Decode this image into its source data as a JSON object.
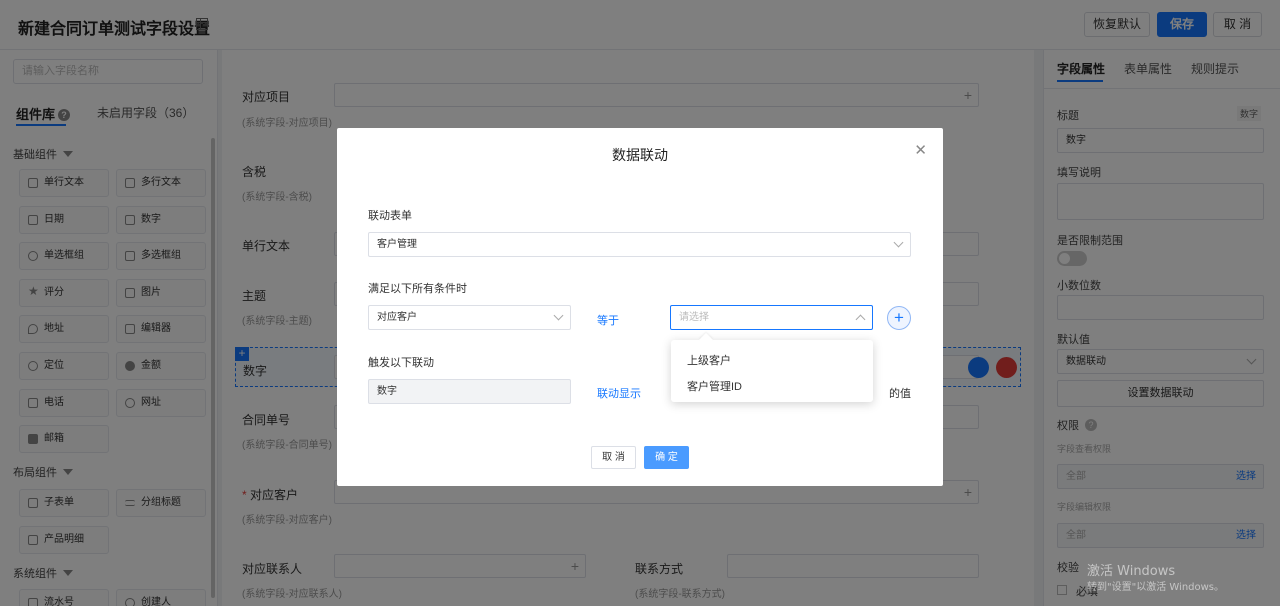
{
  "header": {
    "title": "新建合同订单测试字段设置",
    "btn_restore": "恢复默认",
    "btn_save": "保存",
    "btn_cancel": "取 消"
  },
  "left": {
    "search_placeholder": "请输入字段名称",
    "tab_library": "组件库",
    "tab_unused": "未启用字段（36）",
    "groups": {
      "basic": "基础组件",
      "layout": "布局组件",
      "system": "系统组件"
    },
    "basic_items": [
      "单行文本",
      "多行文本",
      "日期",
      "数字",
      "单选框组",
      "多选框组",
      "评分",
      "图片",
      "地址",
      "编辑器",
      "定位",
      "金额",
      "电话",
      "网址",
      "邮箱"
    ],
    "layout_items": [
      "子表单",
      "分组标题",
      "产品明细"
    ],
    "system_items": [
      "流水号",
      "创建人"
    ]
  },
  "form": {
    "f1_label": "对应项目",
    "f1_sub": "(系统字段-对应项目)",
    "f2_label": "含税",
    "f2_sub": "(系统字段-含税)",
    "f3_label": "单行文本",
    "f4_label": "主题",
    "f4_sub": "(系统字段-主题)",
    "f5_label": "数字",
    "f6_label": "合同单号",
    "f6_sub": "(系统字段-合同单号)",
    "f7_label": "对应客户",
    "f7_sub": "(系统字段-对应客户)",
    "f8_label": "对应联系人",
    "f8_sub": "(系统字段-对应联系人)",
    "f9_label": "联系方式",
    "f9_sub": "(系统字段-联系方式)"
  },
  "right": {
    "tab_field": "字段属性",
    "tab_form": "表单属性",
    "tab_rule": "规则提示",
    "title_label": "标题",
    "title_type": "数字",
    "title_value": "数字",
    "desc_label": "填写说明",
    "limit_label": "是否限制范围",
    "decimal_label": "小数位数",
    "default_label": "默认值",
    "default_value": "数据联动",
    "set_linkage_btn": "设置数据联动",
    "perm_label": "权限",
    "view_perm": "字段查看权限",
    "view_value": "全部",
    "view_select": "选择",
    "edit_perm": "字段编辑权限",
    "edit_value": "全部",
    "edit_select": "选择",
    "verify_label": "校验",
    "required_label": "必填"
  },
  "modal": {
    "title": "数据联动",
    "form_label": "联动表单",
    "form_value": "客户管理",
    "cond_label": "满足以下所有条件时",
    "cond_field": "对应客户",
    "cond_op": "等于",
    "cond_placeholder": "请选择",
    "trigger_label": "触发以下联动",
    "trigger_field": "数字",
    "trigger_action": "联动显示",
    "trigger_suffix": "的值",
    "options": [
      "上级客户",
      "客户管理ID"
    ],
    "cancel": "取 消",
    "ok": "确 定"
  },
  "watermark": {
    "line1": "激活 Windows",
    "line2": "转到\"设置\"以激活 Windows。"
  },
  "colors": {
    "primary": "#1677ff",
    "danger": "#e23c39"
  }
}
